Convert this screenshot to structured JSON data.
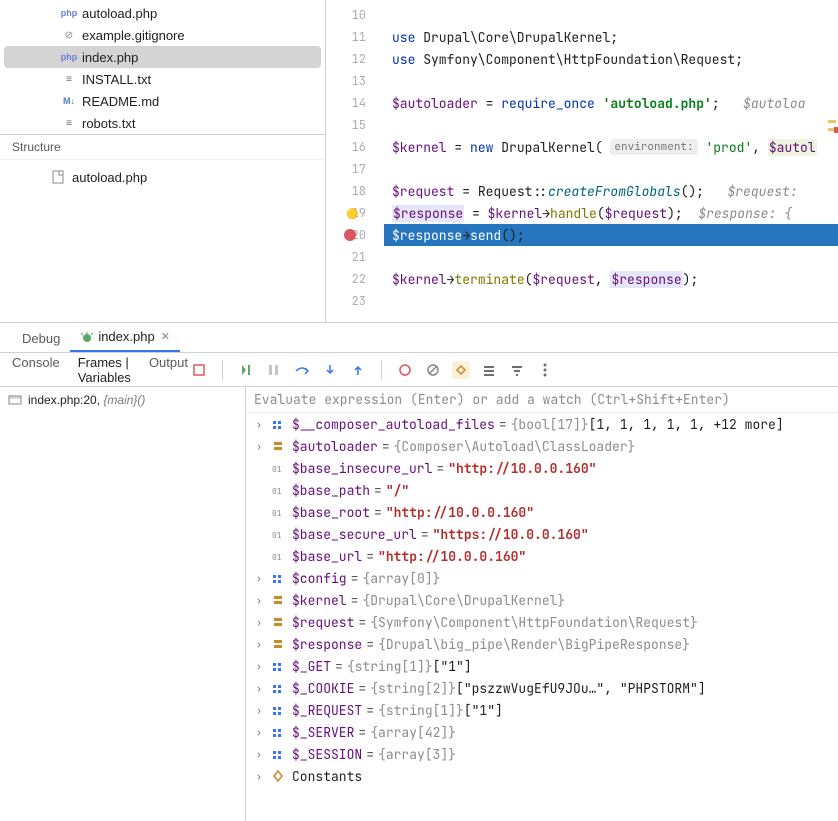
{
  "file_tree": [
    {
      "icon": "php",
      "name": "autoload.php",
      "selected": false
    },
    {
      "icon": "ignore",
      "name": "example.gitignore",
      "selected": false
    },
    {
      "icon": "php",
      "name": "index.php",
      "selected": true
    },
    {
      "icon": "txt",
      "name": "INSTALL.txt",
      "selected": false
    },
    {
      "icon": "md",
      "name": "README.md",
      "selected": false
    },
    {
      "icon": "txt",
      "name": "robots.txt",
      "selected": false
    }
  ],
  "structure": {
    "title": "Structure",
    "items": [
      {
        "name": "autoload.php"
      }
    ]
  },
  "editor": {
    "lines": [
      {
        "n": 10,
        "tokens": []
      },
      {
        "n": 11,
        "tokens": [
          {
            "t": "kw",
            "s": "use "
          },
          {
            "t": "ns",
            "s": "Drupal\\Core\\DrupalKernel"
          },
          {
            "t": "ns",
            "s": ";"
          }
        ]
      },
      {
        "n": 12,
        "tokens": [
          {
            "t": "kw",
            "s": "use "
          },
          {
            "t": "ns",
            "s": "Symfony\\Component\\HttpFoundation\\Request"
          },
          {
            "t": "ns",
            "s": ";"
          }
        ]
      },
      {
        "n": 13,
        "tokens": []
      },
      {
        "n": 14,
        "tokens": [
          {
            "t": "var",
            "s": "$autoloader"
          },
          {
            "t": "ns",
            "s": " = "
          },
          {
            "t": "kw",
            "s": "require_once "
          },
          {
            "t": "strbold",
            "s": "'autoload.php'"
          },
          {
            "t": "ns",
            "s": ";   "
          },
          {
            "t": "hint",
            "s": "$autoloa"
          }
        ]
      },
      {
        "n": 15,
        "tokens": []
      },
      {
        "n": 16,
        "tokens": [
          {
            "t": "var",
            "s": "$kernel"
          },
          {
            "t": "ns",
            "s": " = "
          },
          {
            "t": "kw",
            "s": "new "
          },
          {
            "t": "ns",
            "s": "DrupalKernel( "
          },
          {
            "t": "hintbg",
            "s": "environment:"
          },
          {
            "t": "ns",
            "s": " "
          },
          {
            "t": "str",
            "s": "'prod'"
          },
          {
            "t": "ns",
            "s": ", "
          },
          {
            "t": "boxvar2",
            "s": "$autol"
          }
        ]
      },
      {
        "n": 17,
        "tokens": []
      },
      {
        "n": 18,
        "tokens": [
          {
            "t": "var",
            "s": "$request"
          },
          {
            "t": "ns",
            "s": " = "
          },
          {
            "t": "ns",
            "s": "Request"
          },
          {
            "t": "ns",
            "s": "::"
          },
          {
            "t": "fnital",
            "s": "createFromGlobals"
          },
          {
            "t": "ns",
            "s": "();   "
          },
          {
            "t": "hint",
            "s": "$request:"
          }
        ]
      },
      {
        "n": 19,
        "warn": true,
        "tokens": [
          {
            "t": "boxvar",
            "s": "$response"
          },
          {
            "t": "ns",
            "s": " = "
          },
          {
            "t": "var",
            "s": "$kernel"
          },
          {
            "t": "ns",
            "s": "→"
          },
          {
            "t": "fn",
            "s": "handle"
          },
          {
            "t": "ns",
            "s": "("
          },
          {
            "t": "var",
            "s": "$request"
          },
          {
            "t": "ns",
            "s": ");  "
          },
          {
            "t": "hint",
            "s": "$response: {"
          }
        ]
      },
      {
        "n": 20,
        "bp": true,
        "hl": true,
        "tokens": [
          {
            "t": "var",
            "s": "$response"
          },
          {
            "t": "ns",
            "s": "→"
          },
          {
            "t": "fn",
            "s": "send"
          },
          {
            "t": "ns",
            "s": "();"
          }
        ]
      },
      {
        "n": 21,
        "tokens": []
      },
      {
        "n": 22,
        "tokens": [
          {
            "t": "var",
            "s": "$kernel"
          },
          {
            "t": "ns",
            "s": "→"
          },
          {
            "t": "fn",
            "s": "terminate"
          },
          {
            "t": "ns",
            "s": "("
          },
          {
            "t": "var",
            "s": "$request"
          },
          {
            "t": "ns",
            "s": ", "
          },
          {
            "t": "boxvar",
            "s": "$response"
          },
          {
            "t": "ns",
            "s": ");"
          }
        ]
      },
      {
        "n": 23,
        "tokens": []
      }
    ]
  },
  "debug": {
    "tabs": [
      {
        "label": "Debug",
        "active": false
      },
      {
        "label": "index.php",
        "active": true,
        "icon": "bug",
        "closable": true
      }
    ],
    "toolbar_left": [
      "Console",
      "Frames | Variables",
      "Output"
    ],
    "toolbar_active": 1,
    "frame": {
      "file": "index.php:20",
      "fn": "{main}()"
    },
    "eval_placeholder": "Evaluate expression (Enter) or add a watch (Ctrl+Shift+Enter)",
    "vars": [
      {
        "icon": "arr",
        "arrow": true,
        "name": "$__composer_autoload_files",
        "type": "{bool[17]}",
        "val": "[1, 1, 1, 1, 1, +12 more]"
      },
      {
        "icon": "obj",
        "arrow": true,
        "name": "$autoloader",
        "type": "{Composer\\Autoload\\ClassLoader}",
        "val": ""
      },
      {
        "icon": "prim",
        "arrow": false,
        "name": "$base_insecure_url",
        "type": "",
        "valred": "\"http://10.0.0.160\""
      },
      {
        "icon": "prim",
        "arrow": false,
        "name": "$base_path",
        "type": "",
        "valred": "\"/\""
      },
      {
        "icon": "prim",
        "arrow": false,
        "name": "$base_root",
        "type": "",
        "valred": "\"http://10.0.0.160\""
      },
      {
        "icon": "prim",
        "arrow": false,
        "name": "$base_secure_url",
        "type": "",
        "valred": "\"https://10.0.0.160\""
      },
      {
        "icon": "prim",
        "arrow": false,
        "name": "$base_url",
        "type": "",
        "valred": "\"http://10.0.0.160\""
      },
      {
        "icon": "arr",
        "arrow": true,
        "name": "$config",
        "type": "{array[0]}",
        "val": ""
      },
      {
        "icon": "obj",
        "arrow": true,
        "name": "$kernel",
        "type": "{Drupal\\Core\\DrupalKernel}",
        "val": ""
      },
      {
        "icon": "obj",
        "arrow": true,
        "name": "$request",
        "type": "{Symfony\\Component\\HttpFoundation\\Request}",
        "val": ""
      },
      {
        "icon": "obj",
        "arrow": true,
        "name": "$response",
        "type": "{Drupal\\big_pipe\\Render\\BigPipeResponse}",
        "val": ""
      },
      {
        "icon": "arr",
        "arrow": true,
        "name": "$_GET",
        "type": "{string[1]}",
        "val": "[\"1\"]"
      },
      {
        "icon": "arr",
        "arrow": true,
        "name": "$_COOKIE",
        "type": "{string[2]}",
        "val": "[\"pszzwVugEfU9JOu…\", \"PHPSTORM\"]"
      },
      {
        "icon": "arr",
        "arrow": true,
        "name": "$_REQUEST",
        "type": "{string[1]}",
        "val": "[\"1\"]"
      },
      {
        "icon": "arr",
        "arrow": true,
        "name": "$_SERVER",
        "type": "{array[42]}",
        "val": ""
      },
      {
        "icon": "arr",
        "arrow": true,
        "name": "$_SESSION",
        "type": "{array[3]}",
        "val": ""
      },
      {
        "icon": "const",
        "arrow": true,
        "name": "Constants",
        "plain": true
      }
    ]
  }
}
